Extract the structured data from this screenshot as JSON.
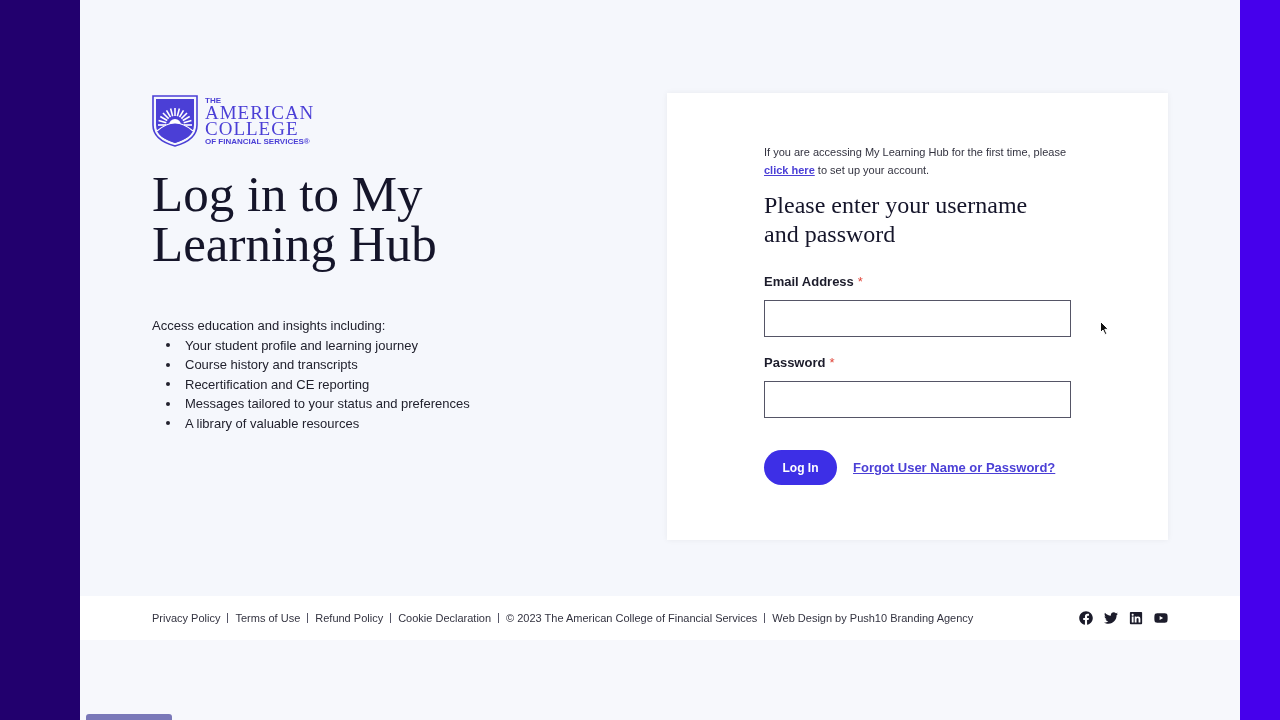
{
  "logo": {
    "top": "THE",
    "lines": [
      "AMERICAN",
      "COLLEGE"
    ],
    "sub": "OF FINANCIAL SERVICES®"
  },
  "heading": "Log in to My Learning Hub",
  "intro": "Access education and insights including:",
  "features": [
    "Your student profile and learning journey",
    "Course history and transcripts",
    "Recertification and CE reporting",
    "Messages tailored to your status and preferences",
    "A library of valuable resources"
  ],
  "login_card": {
    "notice_before": "If you are accessing My Learning Hub for the first time, please",
    "notice_link": "click here",
    "notice_after": "to set up your account.",
    "title": "Please enter your username and password",
    "fields": [
      {
        "label": "Email Address",
        "mark": "*"
      },
      {
        "label": "Password",
        "mark": "*"
      }
    ],
    "submit": "Log In",
    "forgot_link": "Forgot User Name or Password?"
  },
  "footer": {
    "links_before": [
      "Privacy Policy",
      "Terms of Use",
      "Refund Policy",
      "Cookie Declaration"
    ],
    "copyright": "© 2023 The American College of Financial Services",
    "links_after": [
      "Web Design by Push10 Branding Agency"
    ]
  }
}
